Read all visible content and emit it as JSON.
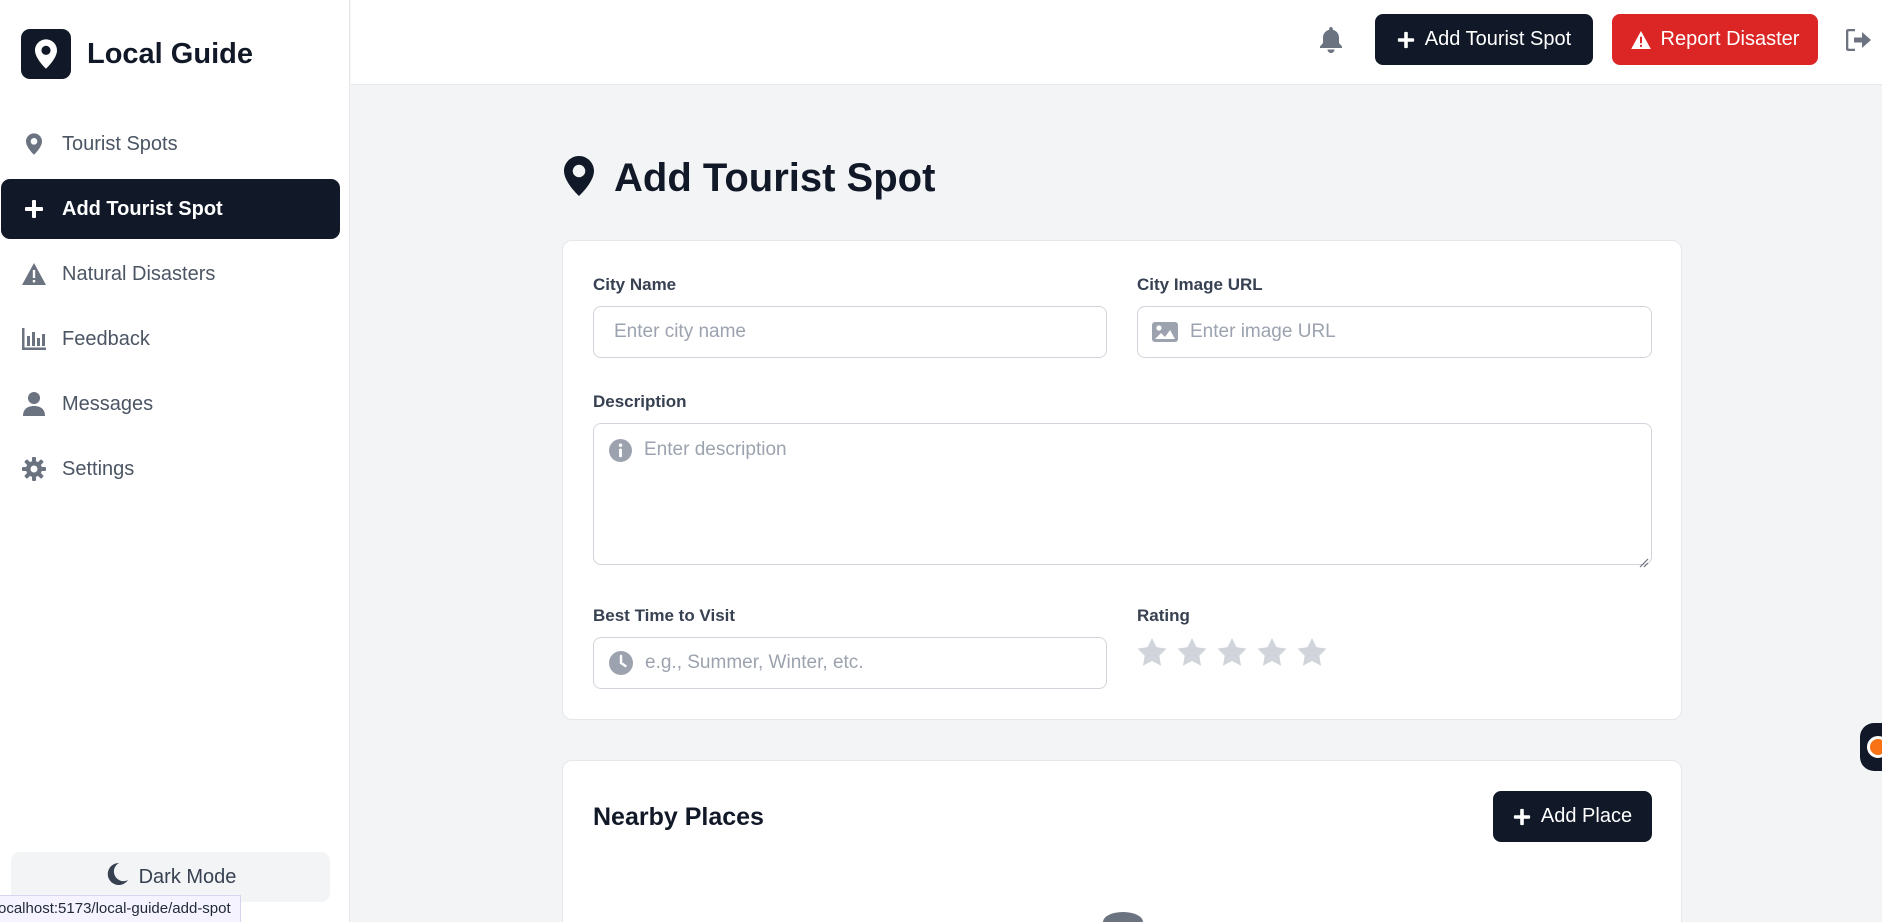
{
  "brand": {
    "name": "Local Guide"
  },
  "sidebar": {
    "items": [
      {
        "label": "Tourist Spots",
        "icon": "map-pin-icon",
        "active": false
      },
      {
        "label": "Add Tourist Spot",
        "icon": "plus-icon",
        "active": true
      },
      {
        "label": "Natural Disasters",
        "icon": "warning-icon",
        "active": false
      },
      {
        "label": "Feedback",
        "icon": "bar-chart-icon",
        "active": false
      },
      {
        "label": "Messages",
        "icon": "user-icon",
        "active": false
      },
      {
        "label": "Settings",
        "icon": "gear-icon",
        "active": false
      }
    ],
    "dark_mode_label": "Dark Mode"
  },
  "status_bar": {
    "url": "ocalhost:5173/local-guide/add-spot"
  },
  "topbar": {
    "add_spot_label": "Add Tourist Spot",
    "report_disaster_label": "Report Disaster"
  },
  "page": {
    "title": "Add Tourist Spot"
  },
  "form": {
    "city_name": {
      "label": "City Name",
      "placeholder": "Enter city name"
    },
    "city_image": {
      "label": "City Image URL",
      "placeholder": "Enter image URL"
    },
    "description": {
      "label": "Description",
      "placeholder": "Enter description"
    },
    "best_time": {
      "label": "Best Time to Visit",
      "placeholder": "e.g., Summer, Winter, etc."
    },
    "rating": {
      "label": "Rating",
      "value": 0,
      "max": 5
    }
  },
  "nearby": {
    "title": "Nearby Places",
    "add_label": "Add Place"
  },
  "colors": {
    "primary": "#111827",
    "danger": "#dc2626",
    "background": "#f3f4f6",
    "muted": "#9ca3af",
    "star_empty": "#d1d5db"
  }
}
